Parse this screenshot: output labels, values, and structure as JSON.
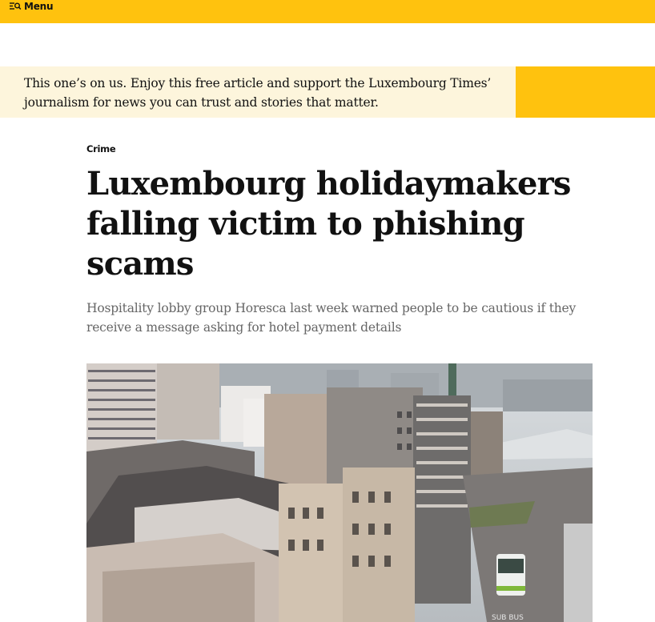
{
  "topbar": {
    "menu_label": "Menu",
    "menu_icon": "search-menu-icon",
    "background_color": "#ffc20e"
  },
  "promo": {
    "text": "This one’s on us. Enjoy this free article and support the Luxembourg Times’ journalism for news you can trust and stories that matter.",
    "background_color": "#fdf5dc",
    "accent_color": "#ffc20e"
  },
  "article": {
    "category": "Crime",
    "headline": "Luxembourg holidaymakers falling victim to phishing scams",
    "subheadline": "Hospitality lobby group Horesca last week warned people to be cautious if they receive a message asking for hotel payment details"
  },
  "hero_image": {
    "description": "city-rooftops-photo",
    "road_marking": "SUB BUS"
  }
}
